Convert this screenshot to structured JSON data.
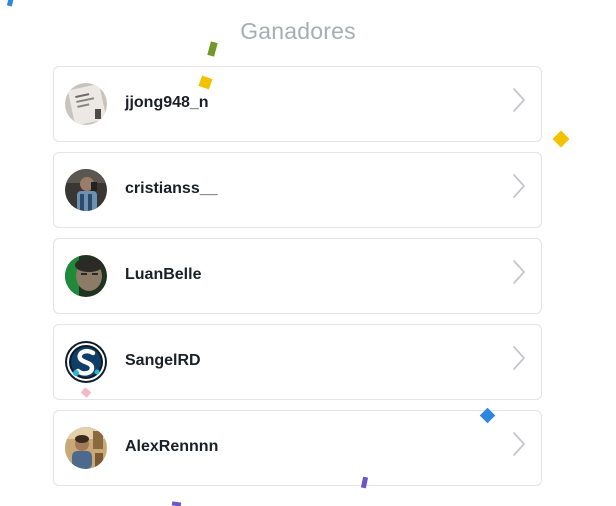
{
  "page": {
    "title": "Ganadores"
  },
  "winners": [
    {
      "username": "jjong948_n",
      "avatar_icon": "paper-note-avatar-icon"
    },
    {
      "username": "cristianss__",
      "avatar_icon": "mirror-selfie-avatar-icon"
    },
    {
      "username": "LuanBelle",
      "avatar_icon": "face-green-avatar-icon"
    },
    {
      "username": "SangelRD",
      "avatar_icon": "letter-s-logo-avatar-icon"
    },
    {
      "username": "AlexRennnn",
      "avatar_icon": "person-room-avatar-icon"
    }
  ],
  "icons": {
    "chevron": "chevron-right-icon"
  },
  "colors": {
    "title": "#a8acb3",
    "card_border": "#e2e4e8",
    "username": "#1b1f27",
    "chevron": "#c4c7cc",
    "confetti_yellow": "#f2c200",
    "confetti_green": "#6f9a2a",
    "confetti_blue": "#2e86de",
    "confetti_purple": "#6b55c8",
    "confetti_pink": "#f6b8c8"
  }
}
